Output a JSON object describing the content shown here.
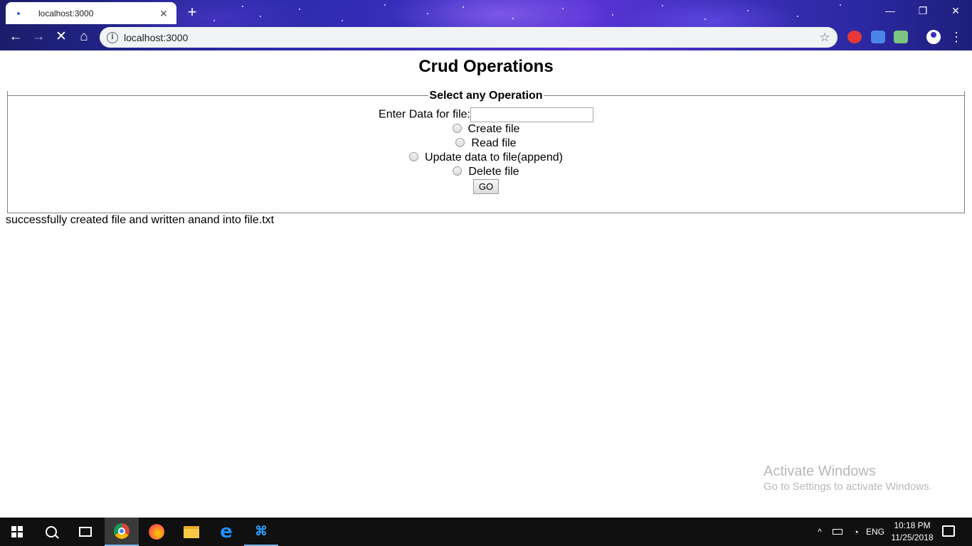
{
  "browser": {
    "tab_title": "localhost:3000",
    "tab_close": "✕",
    "new_tab": "+",
    "url": "localhost:3000",
    "window_controls": {
      "minimize": "—",
      "restore": "❐",
      "close": "✕"
    },
    "nav": {
      "back": "←",
      "forward": "→",
      "stop": "✕",
      "home": "⌂"
    },
    "bookmark_icon": "☆",
    "menu_icon": "⋮",
    "info_icon": "i"
  },
  "page": {
    "title": "Crud Operations",
    "legend": "Select any Operation",
    "input_label": "Enter Data for file:",
    "input_value": "",
    "radios": [
      {
        "label": "Create file"
      },
      {
        "label": "Read file"
      },
      {
        "label": "Update data to file(append)"
      },
      {
        "label": "Delete file"
      }
    ],
    "go_button": "GO",
    "status_message": "successfully created file and written anand into file.txt"
  },
  "watermark": {
    "line1": "Activate Windows",
    "line2": "Go to Settings to activate Windows."
  },
  "taskbar": {
    "language": "ENG",
    "time": "10:18 PM",
    "date": "11/25/2018",
    "tray_chevron": "^"
  }
}
